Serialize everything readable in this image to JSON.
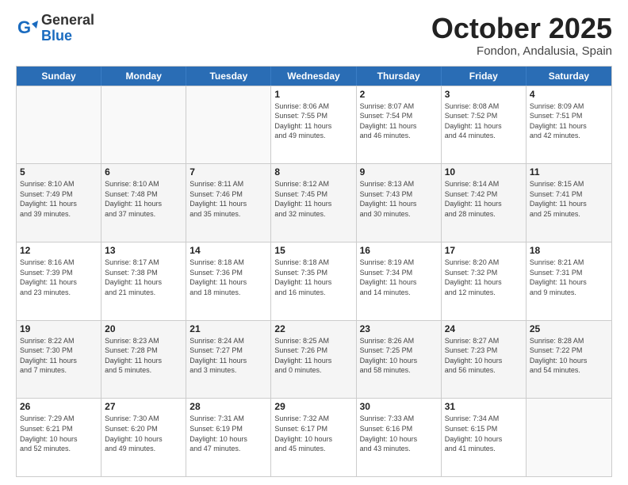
{
  "header": {
    "logo": {
      "line1": "General",
      "line2": "Blue"
    },
    "title": "October 2025",
    "location": "Fondon, Andalusia, Spain"
  },
  "weekdays": [
    "Sunday",
    "Monday",
    "Tuesday",
    "Wednesday",
    "Thursday",
    "Friday",
    "Saturday"
  ],
  "weeks": [
    [
      {
        "day": "",
        "info": ""
      },
      {
        "day": "",
        "info": ""
      },
      {
        "day": "",
        "info": ""
      },
      {
        "day": "1",
        "info": "Sunrise: 8:06 AM\nSunset: 7:55 PM\nDaylight: 11 hours\nand 49 minutes."
      },
      {
        "day": "2",
        "info": "Sunrise: 8:07 AM\nSunset: 7:54 PM\nDaylight: 11 hours\nand 46 minutes."
      },
      {
        "day": "3",
        "info": "Sunrise: 8:08 AM\nSunset: 7:52 PM\nDaylight: 11 hours\nand 44 minutes."
      },
      {
        "day": "4",
        "info": "Sunrise: 8:09 AM\nSunset: 7:51 PM\nDaylight: 11 hours\nand 42 minutes."
      }
    ],
    [
      {
        "day": "5",
        "info": "Sunrise: 8:10 AM\nSunset: 7:49 PM\nDaylight: 11 hours\nand 39 minutes."
      },
      {
        "day": "6",
        "info": "Sunrise: 8:10 AM\nSunset: 7:48 PM\nDaylight: 11 hours\nand 37 minutes."
      },
      {
        "day": "7",
        "info": "Sunrise: 8:11 AM\nSunset: 7:46 PM\nDaylight: 11 hours\nand 35 minutes."
      },
      {
        "day": "8",
        "info": "Sunrise: 8:12 AM\nSunset: 7:45 PM\nDaylight: 11 hours\nand 32 minutes."
      },
      {
        "day": "9",
        "info": "Sunrise: 8:13 AM\nSunset: 7:43 PM\nDaylight: 11 hours\nand 30 minutes."
      },
      {
        "day": "10",
        "info": "Sunrise: 8:14 AM\nSunset: 7:42 PM\nDaylight: 11 hours\nand 28 minutes."
      },
      {
        "day": "11",
        "info": "Sunrise: 8:15 AM\nSunset: 7:41 PM\nDaylight: 11 hours\nand 25 minutes."
      }
    ],
    [
      {
        "day": "12",
        "info": "Sunrise: 8:16 AM\nSunset: 7:39 PM\nDaylight: 11 hours\nand 23 minutes."
      },
      {
        "day": "13",
        "info": "Sunrise: 8:17 AM\nSunset: 7:38 PM\nDaylight: 11 hours\nand 21 minutes."
      },
      {
        "day": "14",
        "info": "Sunrise: 8:18 AM\nSunset: 7:36 PM\nDaylight: 11 hours\nand 18 minutes."
      },
      {
        "day": "15",
        "info": "Sunrise: 8:18 AM\nSunset: 7:35 PM\nDaylight: 11 hours\nand 16 minutes."
      },
      {
        "day": "16",
        "info": "Sunrise: 8:19 AM\nSunset: 7:34 PM\nDaylight: 11 hours\nand 14 minutes."
      },
      {
        "day": "17",
        "info": "Sunrise: 8:20 AM\nSunset: 7:32 PM\nDaylight: 11 hours\nand 12 minutes."
      },
      {
        "day": "18",
        "info": "Sunrise: 8:21 AM\nSunset: 7:31 PM\nDaylight: 11 hours\nand 9 minutes."
      }
    ],
    [
      {
        "day": "19",
        "info": "Sunrise: 8:22 AM\nSunset: 7:30 PM\nDaylight: 11 hours\nand 7 minutes."
      },
      {
        "day": "20",
        "info": "Sunrise: 8:23 AM\nSunset: 7:28 PM\nDaylight: 11 hours\nand 5 minutes."
      },
      {
        "day": "21",
        "info": "Sunrise: 8:24 AM\nSunset: 7:27 PM\nDaylight: 11 hours\nand 3 minutes."
      },
      {
        "day": "22",
        "info": "Sunrise: 8:25 AM\nSunset: 7:26 PM\nDaylight: 11 hours\nand 0 minutes."
      },
      {
        "day": "23",
        "info": "Sunrise: 8:26 AM\nSunset: 7:25 PM\nDaylight: 10 hours\nand 58 minutes."
      },
      {
        "day": "24",
        "info": "Sunrise: 8:27 AM\nSunset: 7:23 PM\nDaylight: 10 hours\nand 56 minutes."
      },
      {
        "day": "25",
        "info": "Sunrise: 8:28 AM\nSunset: 7:22 PM\nDaylight: 10 hours\nand 54 minutes."
      }
    ],
    [
      {
        "day": "26",
        "info": "Sunrise: 7:29 AM\nSunset: 6:21 PM\nDaylight: 10 hours\nand 52 minutes."
      },
      {
        "day": "27",
        "info": "Sunrise: 7:30 AM\nSunset: 6:20 PM\nDaylight: 10 hours\nand 49 minutes."
      },
      {
        "day": "28",
        "info": "Sunrise: 7:31 AM\nSunset: 6:19 PM\nDaylight: 10 hours\nand 47 minutes."
      },
      {
        "day": "29",
        "info": "Sunrise: 7:32 AM\nSunset: 6:17 PM\nDaylight: 10 hours\nand 45 minutes."
      },
      {
        "day": "30",
        "info": "Sunrise: 7:33 AM\nSunset: 6:16 PM\nDaylight: 10 hours\nand 43 minutes."
      },
      {
        "day": "31",
        "info": "Sunrise: 7:34 AM\nSunset: 6:15 PM\nDaylight: 10 hours\nand 41 minutes."
      },
      {
        "day": "",
        "info": ""
      }
    ]
  ]
}
